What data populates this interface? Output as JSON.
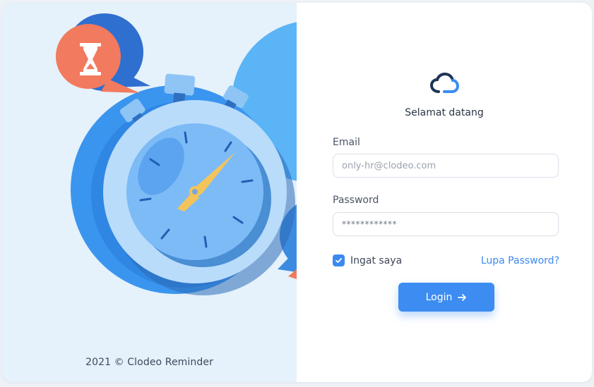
{
  "footer": {
    "text": "2021 © Clodeo Reminder"
  },
  "login": {
    "welcome": "Selamat datang",
    "email_label": "Email",
    "email_placeholder": "only-hr@clodeo.com",
    "password_label": "Password",
    "password_value": "************",
    "remember_label": "Ingat saya",
    "remember_checked": true,
    "forgot_label": "Lupa Password?",
    "login_label": "Login"
  },
  "icons": {
    "logo": "cloud-logo-icon",
    "hourglass": "hourglass-icon",
    "stopwatch": "stopwatch-illustration",
    "check": "check-icon",
    "arrow": "arrow-right-icon"
  },
  "colors": {
    "accent": "#3c8cf2",
    "left_bg": "#e5f1fb",
    "badge": "#f27a5e",
    "logo_dark": "#1d3557"
  }
}
